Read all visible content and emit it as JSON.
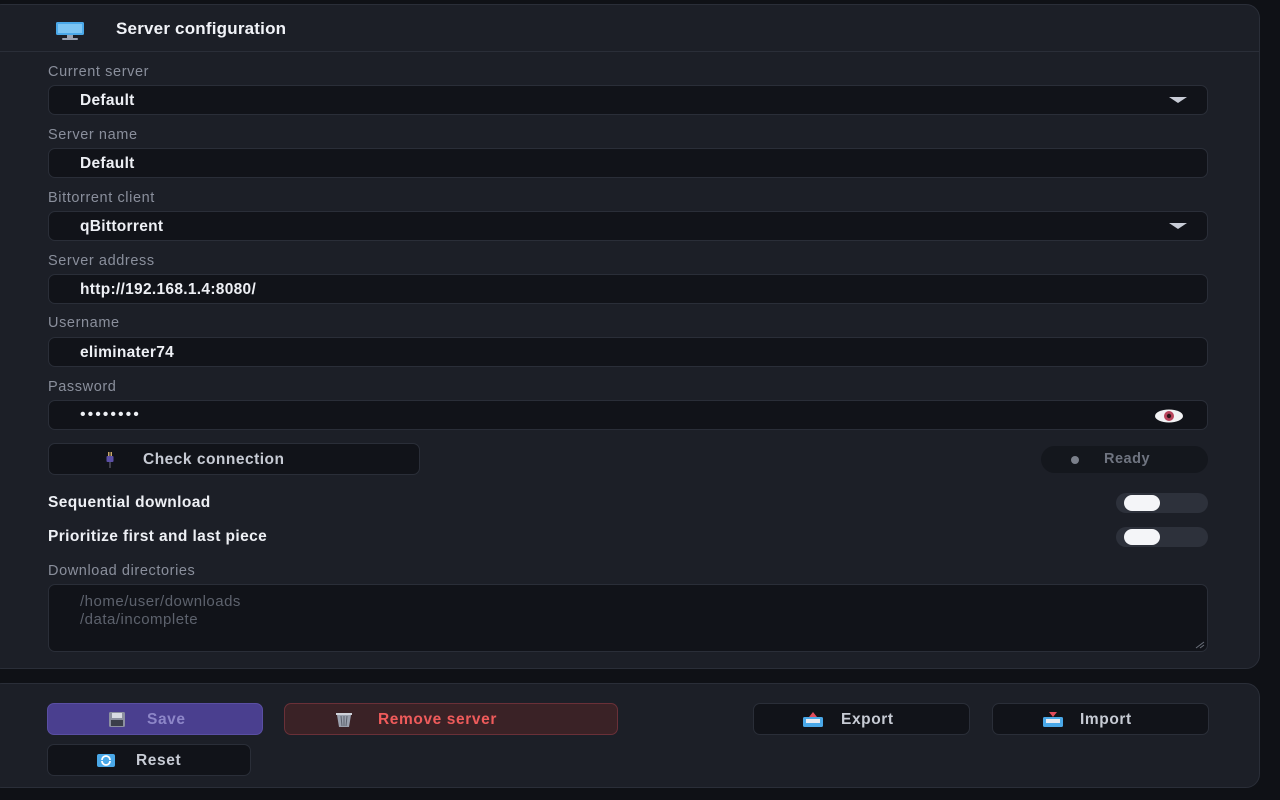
{
  "header": {
    "title": "Server configuration",
    "icon": "monitor-icon"
  },
  "fields": {
    "current_server": {
      "label": "Current server",
      "value": "Default"
    },
    "server_name": {
      "label": "Server name",
      "value": "Default"
    },
    "bittorrent_client": {
      "label": "Bittorrent client",
      "value": "qBittorrent"
    },
    "server_address": {
      "label": "Server address",
      "value": "http://192.168.1.4:8080/"
    },
    "username": {
      "label": "Username",
      "value": "eliminater74"
    },
    "password": {
      "label": "Password",
      "masked_value": "••••••••"
    }
  },
  "connection": {
    "check_label": "Check connection",
    "status": "Ready"
  },
  "toggles": {
    "sequential": {
      "label": "Sequential download",
      "on": false
    },
    "prioritize": {
      "label": "Prioritize first and last piece",
      "on": false
    }
  },
  "directories": {
    "label": "Download directories",
    "placeholder_lines": [
      "/home/user/downloads",
      "/data/incomplete"
    ]
  },
  "actions": {
    "save": "Save",
    "remove": "Remove server",
    "export": "Export",
    "import": "Import",
    "reset": "Reset"
  },
  "colors": {
    "accent": "#4a3f8f",
    "danger": "#ef5b5b",
    "background": "#0f1116",
    "panel": "#1c1f27"
  }
}
